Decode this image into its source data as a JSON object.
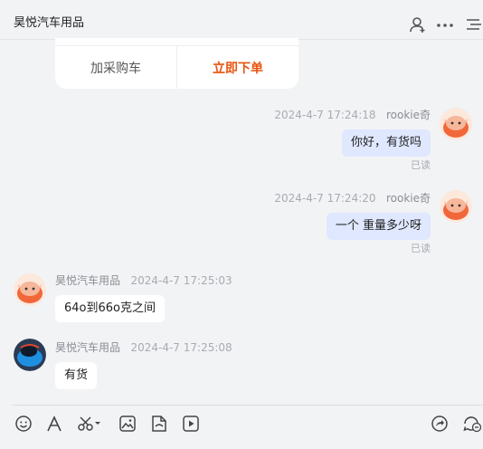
{
  "header": {
    "title": "昊悦汽车用品"
  },
  "card": {
    "add_to_cart": "加采购车",
    "buy_now": "立即下单"
  },
  "messages": [
    {
      "from": "me",
      "time": "2024-4-7 17:24:18",
      "name": "rookie奇",
      "text": "你好，有货吗",
      "status": "已读"
    },
    {
      "from": "me",
      "time": "2024-4-7 17:24:20",
      "name": "rookie奇",
      "text": "一个  重量多少呀",
      "status": "已读"
    },
    {
      "from": "other",
      "time": "2024-4-7 17:25:03",
      "name": "昊悦汽车用品",
      "text": "64o到66o克之间"
    },
    {
      "from": "other",
      "time": "2024-4-7 17:25:08",
      "name": "昊悦汽车用品",
      "text": "有货"
    }
  ],
  "colors": {
    "accent_buy": "#e8530e",
    "my_bubble": "#dfe8ff",
    "background": "#f2f3f5"
  },
  "toolbar_icons": [
    "emoji-icon",
    "font-icon",
    "scissors-icon",
    "image-icon",
    "file-icon",
    "video-icon",
    "share-icon",
    "quick-reply-icon"
  ],
  "header_icons": [
    "add-contact-icon",
    "more-icon",
    "list-icon"
  ]
}
